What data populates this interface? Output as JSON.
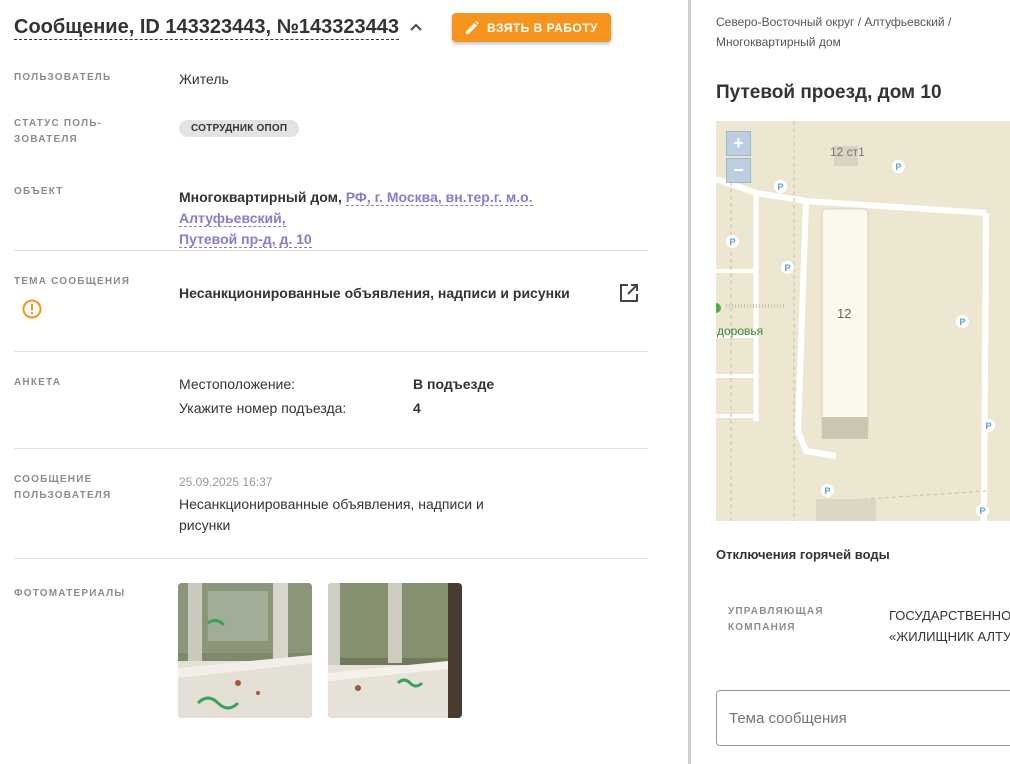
{
  "header": {
    "title": "Сообщение, ID 143323443, №143323443",
    "take_button": "ВЗЯТЬ В РАБОТУ"
  },
  "fields": {
    "user": {
      "label": "ПОЛЬЗОВАТЕЛЬ",
      "value": "Житель"
    },
    "user_status": {
      "label_line1": "СТАТУС ПОЛЬ-",
      "label_line2": "ЗОВАТЕЛЯ",
      "badge": "СОТРУДНИК ОПОП"
    },
    "object": {
      "label": "ОБЪЕКТ",
      "type": "Многоквартирный дом,",
      "address_line1": "РФ, г. Москва, вн.тер.г. м.о. Алтуфьевский,",
      "address_line2": "Путевой пр-д, д. 10"
    },
    "topic": {
      "label": "ТЕМА СООБЩЕНИЯ",
      "value": "Несанкционированные объявления, надписи и рисунки"
    },
    "survey": {
      "label": "АНКЕТА",
      "rows": [
        {
          "q": "Местоположение:",
          "a": "В подъезде"
        },
        {
          "q": "Укажите номер подъезда:",
          "a": "4"
        }
      ]
    },
    "user_message": {
      "label_line1": "СООБЩЕНИЕ",
      "label_line2": "ПОЛЬЗОВАТЕЛЯ",
      "date": "25.09.2025 16:37",
      "text_line1": "Несанкционированные объявления, надписи и",
      "text_line2": "рисунки"
    },
    "photos": {
      "label": "ФОТОМАТЕРИАЛЫ"
    }
  },
  "right": {
    "breadcrumb_line1": "Северо-Восточный округ / Алтуфьевский /",
    "breadcrumb_line2": "Многоквартирный дом",
    "address": "Путевой проезд, дом 10",
    "map": {
      "zoom_in": "+",
      "zoom_out": "−",
      "building_label_1": "12 ст1",
      "building_label_2": "12",
      "poi_label": "доровья",
      "parking": "P"
    },
    "hot_water": "Отключения горячей воды",
    "mgmt_label_line1": "УПРАВЛЯЮЩАЯ",
    "mgmt_label_line2": "КОМПАНИЯ",
    "mgmt_value_line1": "ГОСУДАРСТВЕННОЕ",
    "mgmt_value_line2": "«ЖИЛИЩНИК АЛТУФЬЕВСКИЙ»",
    "subject_placeholder": "Тема сообщения"
  },
  "colors": {
    "accent": "#f7941d",
    "link": "#8a7bc8",
    "warning": "#f7941d",
    "map_bg": "#ede7d2"
  },
  "icons": [
    "chevron-up-icon",
    "pencil-icon",
    "warning-circle-icon",
    "open-external-icon",
    "parking-icon"
  ]
}
